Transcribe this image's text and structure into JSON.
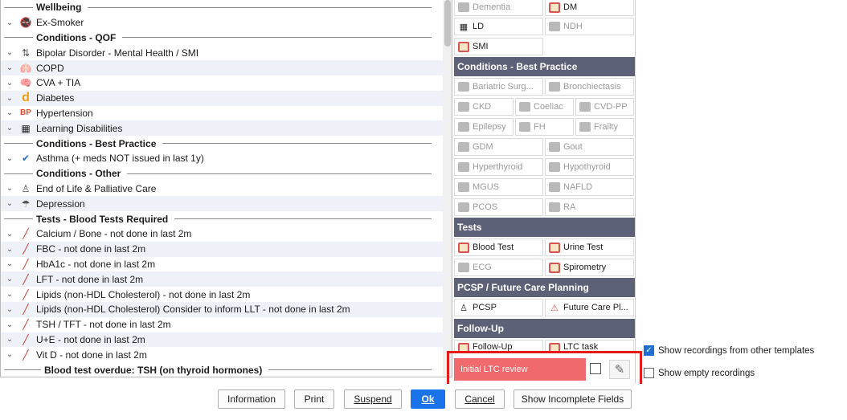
{
  "left_list": [
    {
      "kind": "header",
      "label": "Wellbeing"
    },
    {
      "kind": "item",
      "icon": "no-smoking-icon",
      "glyph": "🚭",
      "label": "Ex-Smoker"
    },
    {
      "kind": "header",
      "label": "Conditions - QOF"
    },
    {
      "kind": "item",
      "icon": "mood-chart-icon",
      "glyph": "⇅",
      "label": "Bipolar Disorder - Mental Health / SMI"
    },
    {
      "kind": "item",
      "icon": "lungs-icon",
      "glyph": "🫁",
      "label": "COPD"
    },
    {
      "kind": "item",
      "icon": "brain-icon",
      "glyph": "🧠",
      "label": "CVA + TIA"
    },
    {
      "kind": "item",
      "icon": "diabetes-d-icon",
      "glyph": "d",
      "label": "Diabetes"
    },
    {
      "kind": "item",
      "icon": "bp-icon",
      "glyph": "BP",
      "label": "Hypertension"
    },
    {
      "kind": "item",
      "icon": "ld-icon",
      "glyph": "▦",
      "label": "Learning Disabilities"
    },
    {
      "kind": "header",
      "label": "Conditions - Best Practice"
    },
    {
      "kind": "item",
      "icon": "checkmark-icon",
      "glyph": "✔",
      "label": "Asthma (+ meds NOT issued in last 1y)"
    },
    {
      "kind": "header",
      "label": "Conditions - Other"
    },
    {
      "kind": "item",
      "icon": "person-icon",
      "glyph": "♙",
      "label": "End of Life & Palliative Care"
    },
    {
      "kind": "item",
      "icon": "rain-cloud-icon",
      "glyph": "☂",
      "label": "Depression"
    },
    {
      "kind": "header",
      "label": "Tests - Blood Tests Required"
    },
    {
      "kind": "item",
      "icon": "syringe-icon",
      "glyph": "╱",
      "label": "Calcium / Bone - not done in last 2m"
    },
    {
      "kind": "item",
      "icon": "syringe-icon",
      "glyph": "╱",
      "label": "FBC - not done in last 2m"
    },
    {
      "kind": "item",
      "icon": "syringe-icon",
      "glyph": "╱",
      "label": "HbA1c - not done in last 2m"
    },
    {
      "kind": "item",
      "icon": "syringe-icon",
      "glyph": "╱",
      "label": "LFT - not done in last 2m"
    },
    {
      "kind": "item",
      "icon": "syringe-icon",
      "glyph": "╱",
      "label": "Lipids (non-HDL Cholesterol) - not done in last 2m"
    },
    {
      "kind": "item",
      "icon": "syringe-icon",
      "glyph": "╱",
      "label": "Lipids (non-HDL Cholesterol) Consider to inform LLT - not done in last 2m"
    },
    {
      "kind": "item",
      "icon": "syringe-icon",
      "glyph": "╱",
      "label": "TSH / TFT - not done in last 2m"
    },
    {
      "kind": "item",
      "icon": "syringe-icon",
      "glyph": "╱",
      "label": "U+E - not done in last 2m"
    },
    {
      "kind": "item",
      "icon": "syringe-icon",
      "glyph": "╱",
      "label": "Vit D - not done in last 2m"
    },
    {
      "kind": "header",
      "label": "Blood test overdue: TSH (on thyroid hormones)"
    }
  ],
  "sections": {
    "best_practice": "Conditions - Best Practice",
    "tests": "Tests",
    "pcsp": "PCSP / Future Care Planning",
    "follow_up": "Follow-Up"
  },
  "tiles": {
    "dementia": "Dementia",
    "dm": "DM",
    "ld": "LD",
    "ndh": "NDH",
    "smi": "SMI",
    "bariatric": "Bariatric Surg...",
    "bronchiectasis": "Bronchiectasis",
    "ckd": "CKD",
    "coeliac": "Coeliac",
    "cvd_pp": "CVD-PP",
    "epilepsy": "Epilepsy",
    "fh": "FH",
    "frailty": "Frailty",
    "gdm": "GDM",
    "gout": "Gout",
    "hyperthyroid": "Hyperthyroid",
    "hypothyroid": "Hypothyroid",
    "mgus": "MGUS",
    "nafld": "NAFLD",
    "pcos": "PCOS",
    "ra": "RA",
    "blood_test": "Blood Test",
    "urine_test": "Urine Test",
    "ecg": "ECG",
    "spirometry": "Spirometry",
    "pcsp": "PCSP",
    "future_care": "Future Care Pl...",
    "follow_up": "Follow-Up",
    "ltc_task": "LTC task"
  },
  "highlight": {
    "initial_ltc": "Initial LTC review"
  },
  "options": {
    "show_other_templates": "Show recordings from other templates",
    "show_empty": "Show empty recordings",
    "show_other_templates_checked": true,
    "show_empty_checked": false
  },
  "buttons": {
    "information": "Information",
    "print": "Print",
    "suspend": "Suspend",
    "ok": "Ok",
    "cancel": "Cancel",
    "show_incomplete": "Show Incomplete Fields"
  },
  "colors": {
    "section_bg": "#5d6178",
    "alert_red": "#f0696c",
    "highlight_border": "#e21b1b",
    "primary_blue": "#1a73e8"
  }
}
